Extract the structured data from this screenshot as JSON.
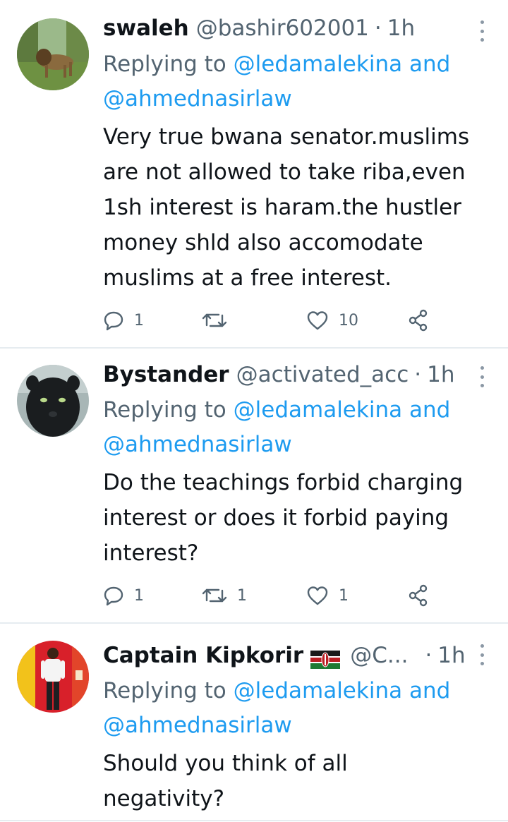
{
  "tweets": [
    {
      "display_name": "swaleh",
      "handle": "@bashir602001",
      "separator": "·",
      "time": "1h",
      "replying_prefix": "Replying to",
      "replying_user1": "@ledamalekina",
      "replying_and": "and",
      "replying_user2": "@ahmednasirlaw",
      "text": "Very true bwana senator.muslims\nare not allowed to take riba,even\n1sh interest is haram.the hustler\nmoney shld also accomodate\nmuslims at a free interest.",
      "reply_count": "1",
      "retweet_count": "",
      "like_count": "10",
      "avatar_icon": "lion-photo-avatar"
    },
    {
      "display_name": "Bystander",
      "handle": "@activated_acc",
      "separator": "·",
      "time": "1h",
      "replying_prefix": "Replying to",
      "replying_user1": "@ledamalekina",
      "replying_and": "and",
      "replying_user2": "@ahmednasirlaw",
      "text": "Do the teachings forbid charging\ninterest or does it forbid paying\ninterest?",
      "reply_count": "1",
      "retweet_count": "1",
      "like_count": "1",
      "avatar_icon": "black-panther-photo-avatar"
    },
    {
      "display_name": "Captain Kipkorir",
      "handle": "@C...",
      "separator": "·",
      "time": "1h",
      "replying_prefix": "Replying to",
      "replying_user1": "@ledamalekina",
      "replying_and": "and",
      "replying_user2": "@ahmednasirlaw",
      "text": "Should you think of all\nnegativity?",
      "avatar_icon": "man-standing-photo-avatar",
      "flag_icon": "kenya-flag-icon"
    }
  ],
  "colors": {
    "link": "#1d9bf0",
    "secondary_text": "#536471",
    "primary_text": "#0f1419",
    "divider": "#e6ecf0"
  }
}
